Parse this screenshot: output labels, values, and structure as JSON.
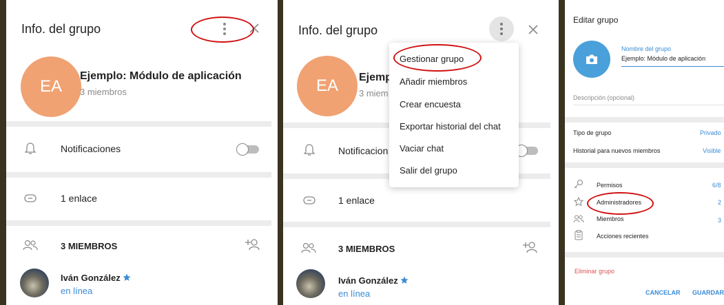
{
  "panel1": {
    "title": "Info. del grupo",
    "avatar_initials": "EA",
    "group_name": "Ejemplo: Módulo de aplicación",
    "group_sub": "3 miembros",
    "notifications_label": "Notificaciones",
    "link_label": "1 enlace",
    "members_header": "3 MIEMBROS",
    "member_name": "Iván González",
    "member_status": "en línea"
  },
  "panel2": {
    "title": "Info. del grupo",
    "avatar_initials": "EA",
    "group_name_partial": "Ejemp",
    "group_sub_partial": "3 miem",
    "notifications_partial": "Notificacion",
    "link_label": "1 enlace",
    "members_header": "3 MIEMBROS",
    "member_name": "Iván González",
    "member_status": "en línea",
    "menu": [
      "Gestionar grupo",
      "Añadir miembros",
      "Crear encuesta",
      "Exportar historial del chat",
      "Vaciar chat",
      "Salir del grupo"
    ]
  },
  "panel3": {
    "title": "Editar grupo",
    "name_label": "Nombre del grupo",
    "name_value": "Ejemplo: Módulo de aplicación",
    "description_placeholder": "Descripción (opcional)",
    "group_type_label": "Tipo de grupo",
    "group_type_value": "Privado",
    "history_label": "Historial para nuevos miembros",
    "history_value": "Visible",
    "permissions_label": "Permisos",
    "permissions_value": "6/8",
    "admins_label": "Administradores",
    "admins_value": "2",
    "members_label": "Miembros",
    "members_value": "3",
    "recent_actions_label": "Acciones recientes",
    "delete_label": "Eliminar grupo",
    "cancel_label": "CANCELAR",
    "save_label": "GUARDAR"
  },
  "colors": {
    "accent": "#3a8bd5",
    "avatar": "#f0a273",
    "camera": "#4aa0da",
    "danger": "#d9534f",
    "highlight": "#d01010"
  }
}
